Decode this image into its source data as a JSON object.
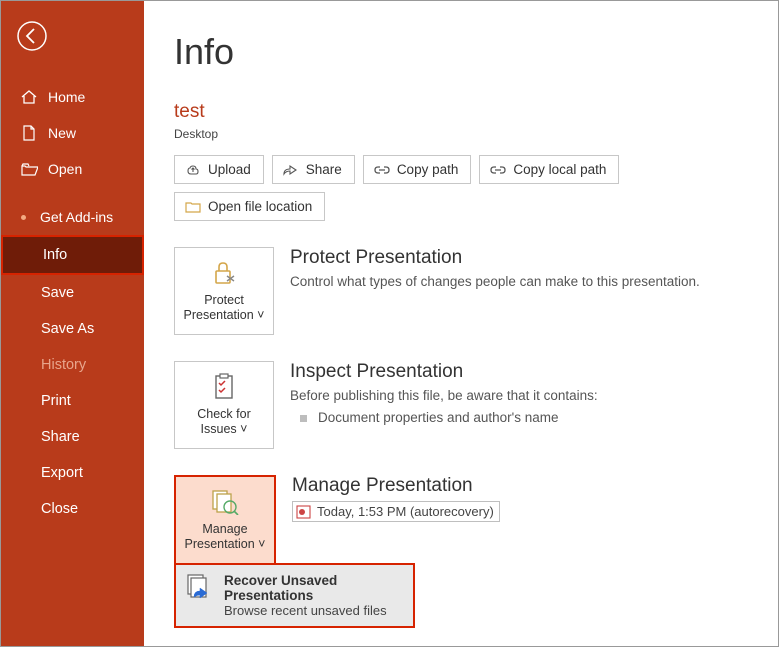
{
  "sidebar": {
    "items": [
      {
        "label": "Home"
      },
      {
        "label": "New"
      },
      {
        "label": "Open"
      },
      {
        "label": "Get Add-ins"
      },
      {
        "label": "Info"
      },
      {
        "label": "Save"
      },
      {
        "label": "Save As"
      },
      {
        "label": "History"
      },
      {
        "label": "Print"
      },
      {
        "label": "Share"
      },
      {
        "label": "Export"
      },
      {
        "label": "Close"
      }
    ]
  },
  "main": {
    "title": "Info",
    "file_name": "test",
    "file_path": "Desktop",
    "buttons": {
      "upload": "Upload",
      "share": "Share",
      "copy_path": "Copy path",
      "copy_local": "Copy local path",
      "open_loc": "Open file location"
    },
    "protect": {
      "tile_line1": "Protect",
      "tile_line2": "Presentation",
      "heading": "Protect Presentation",
      "body": "Control what types of changes people can make to this presentation."
    },
    "inspect": {
      "tile_line1": "Check for",
      "tile_line2": "Issues",
      "heading": "Inspect Presentation",
      "body": "Before publishing this file, be aware that it contains:",
      "item1": "Document properties and author's name"
    },
    "manage": {
      "tile_line1": "Manage",
      "tile_line2": "Presentation",
      "heading": "Manage Presentation",
      "recovery_label": "Today, 1:53 PM (autorecovery)",
      "dropdown_title": "Recover Unsaved Presentations",
      "dropdown_sub": "Browse recent unsaved files"
    }
  }
}
